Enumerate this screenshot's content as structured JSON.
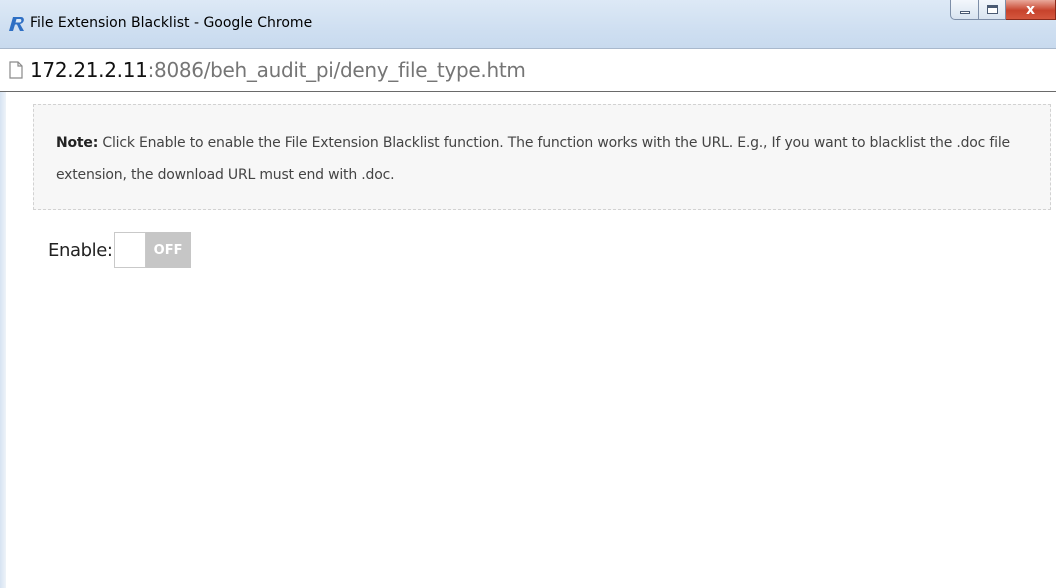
{
  "window": {
    "title": "File Extension Blacklist - Google Chrome",
    "close_glyph": "x",
    "app_icon": "r-logo-icon"
  },
  "address_bar": {
    "url_host": "172.21.2.11",
    "url_path": ":8086/beh_audit_pi/deny_file_type.htm"
  },
  "note": {
    "label": "Note:",
    "text": " Click Enable to enable the File Extension Blacklist function. The function works with the URL. E.g., If you want to blacklist the .doc file extension, the download URL must end with .doc."
  },
  "enable": {
    "label": "Enable:",
    "state_text": "OFF",
    "enabled": false
  },
  "colors": {
    "toggle_off": "#c6c6c6",
    "note_bg": "#f7f7f7",
    "title_bar": "#d3e2f3"
  }
}
